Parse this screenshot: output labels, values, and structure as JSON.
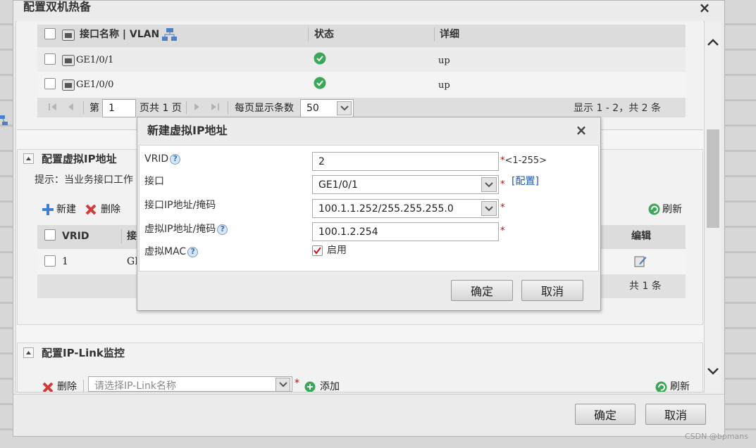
{
  "outer": {
    "title": "配置双机热备",
    "close": "×",
    "ok_label": "确定",
    "cancel_label": "取消",
    "watermark": "CSDN @bpmans"
  },
  "interface_table": {
    "headers": [
      "接口名称 | VLAN",
      "状态",
      "详细"
    ],
    "rows": [
      {
        "name": "GE1/0/1",
        "detail": "up"
      },
      {
        "name": "GE1/0/0",
        "detail": "up"
      }
    ],
    "pager": {
      "page_prefix": "第",
      "page_value": "1",
      "page_suffix": "页共 1 页",
      "per_page_label": "每页显示条数",
      "per_page_value": "50",
      "summary": "显示 1 - 2，共 2 条"
    }
  },
  "vip_section": {
    "title": "配置虚拟IP地址",
    "hint": "提示：当业务接口工作",
    "new_label": "新建",
    "delete_label": "删除",
    "refresh_label": "刷新",
    "headers": {
      "vrid": "VRID",
      "iface": "接",
      "edit": "编辑"
    },
    "row": {
      "vrid": "1",
      "iface": "GI"
    },
    "total": "共 1 条"
  },
  "iplink_section": {
    "title": "配置IP-Link监控",
    "delete_label": "删除",
    "select_placeholder": "请选择IP-Link名称",
    "add_label": "添加",
    "refresh_label": "刷新"
  },
  "dialog": {
    "title": "新建虚拟IP地址",
    "close": "×",
    "vrid_label": "VRID",
    "vrid_value": "2",
    "vrid_hint": "<1-255>",
    "iface_label": "接口",
    "iface_value": "GE1/0/1",
    "iface_config": "[配置]",
    "ipmask_label": "接口IP地址/掩码",
    "ipmask_value": "100.1.1.252/255.255.255.0",
    "vip_label": "虚拟IP地址/掩码",
    "vip_value": "100.1.2.254",
    "mac_label": "虚拟MAC",
    "mac_enable": "启用",
    "ok_label": "确定",
    "cancel_label": "取消",
    "required_mark": "*",
    "help_mark": "?"
  },
  "colors": {
    "link": "#1a55b5",
    "required": "#d00000",
    "status_ok": "#3aa856"
  }
}
